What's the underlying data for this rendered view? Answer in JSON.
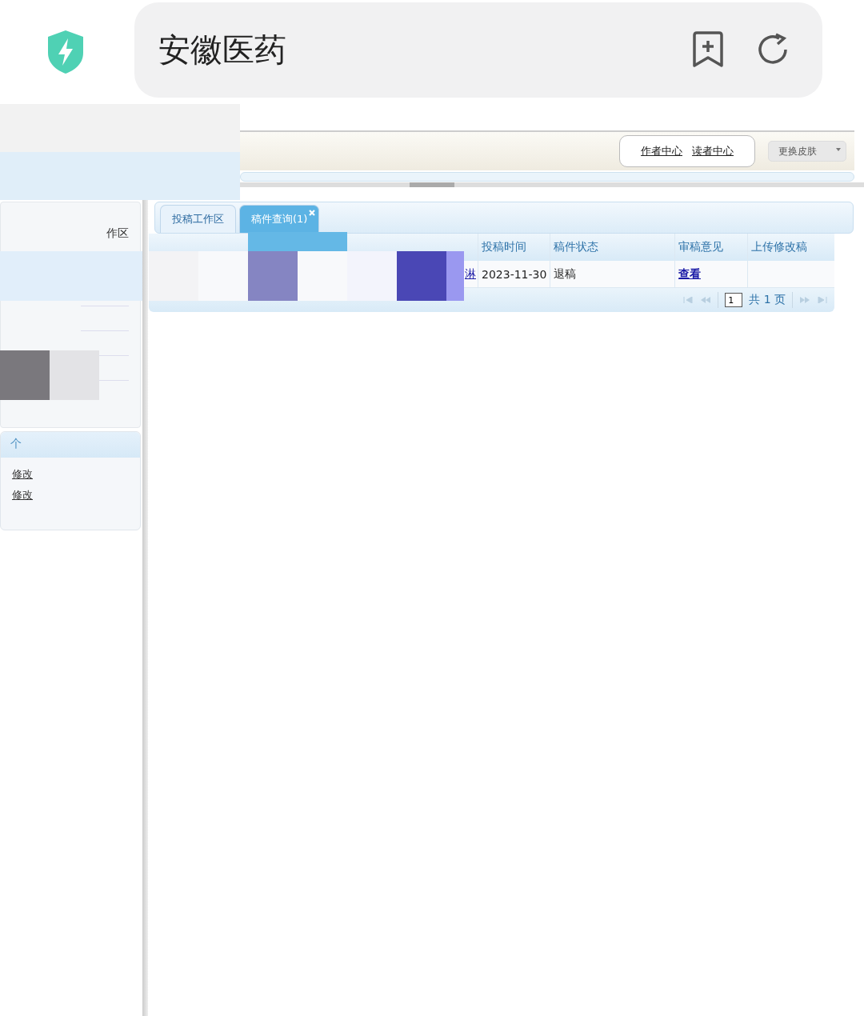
{
  "browser": {
    "address": "安徽医药"
  },
  "header": {
    "links": [
      "作者中心",
      "读者中心"
    ],
    "skin_select": "更换皮肤"
  },
  "sidebar": {
    "items": [
      "作区"
    ],
    "panel_title": "个",
    "links": [
      "修改",
      "修改"
    ]
  },
  "tabs": [
    {
      "label": "投稿工作区",
      "selected": false,
      "closable": false
    },
    {
      "label": "稿件查询(1)",
      "selected": true,
      "closable": true
    }
  ],
  "table": {
    "columns": [
      "投稿时间",
      "稿件状态",
      "审稿意见",
      "上传修改稿"
    ],
    "rows": [
      {
        "column_1": "淋",
        "submitted": "2023-11-30",
        "status": "退稿",
        "review": "查看"
      }
    ]
  },
  "pager": {
    "page": "1",
    "total": "共 1 页"
  }
}
